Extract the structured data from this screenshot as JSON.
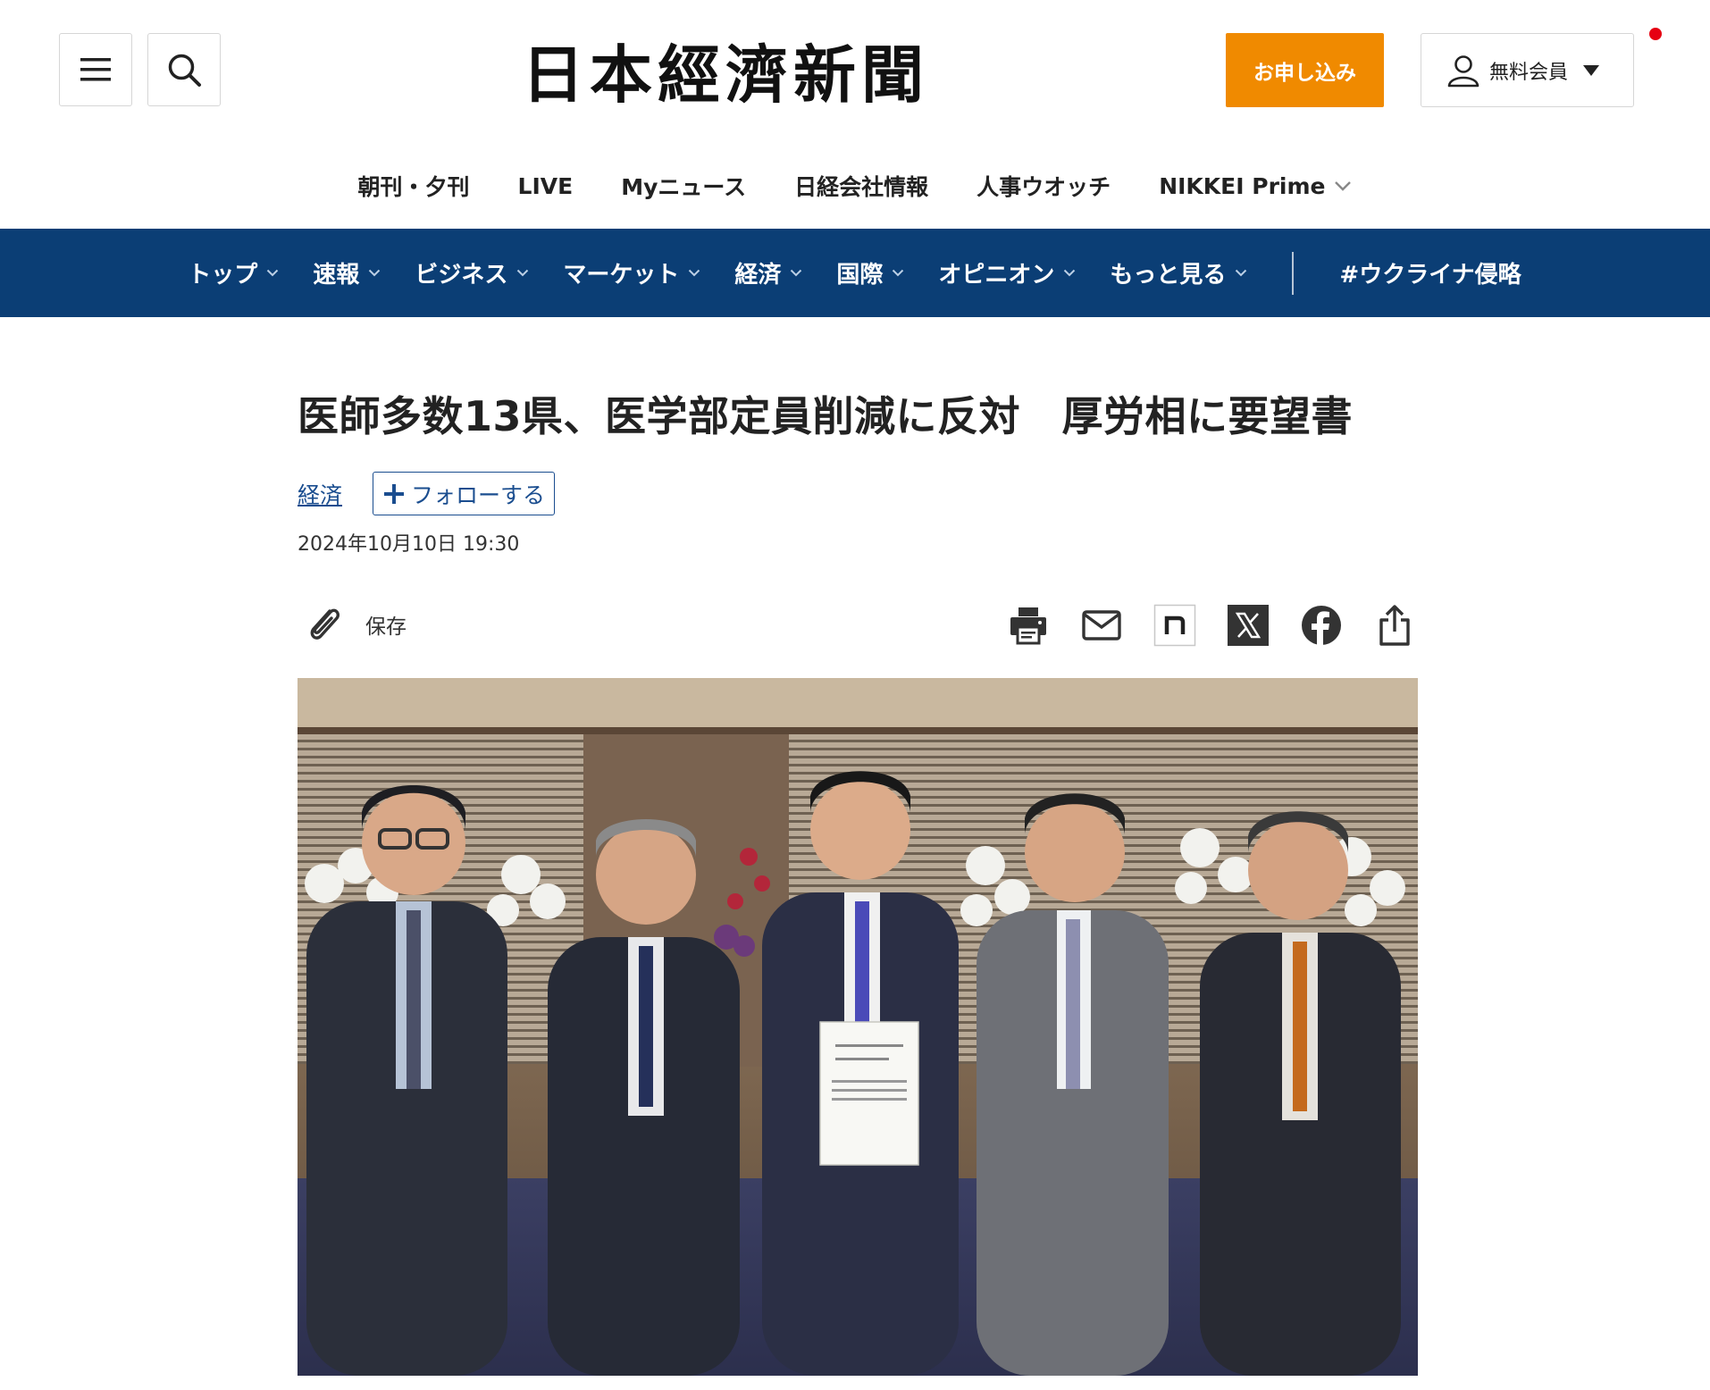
{
  "colors": {
    "nav_blue": "#0b3e75",
    "subscribe_orange": "#f08a00",
    "link_blue": "#1a4d8f",
    "notification_red": "#e60012"
  },
  "header": {
    "logo_text": "日本經濟新聞",
    "subscribe_label": "お申し込み",
    "member_label": "無料会員"
  },
  "subnav": {
    "items": [
      {
        "label": "朝刊・夕刊"
      },
      {
        "label": "LIVE"
      },
      {
        "label": "Myニュース"
      },
      {
        "label": "日経会社情報"
      },
      {
        "label": "人事ウオッチ"
      },
      {
        "label": "NIKKEI Prime"
      }
    ]
  },
  "mainnav": {
    "items": [
      {
        "label": "トップ"
      },
      {
        "label": "速報"
      },
      {
        "label": "ビジネス"
      },
      {
        "label": "マーケット"
      },
      {
        "label": "経済"
      },
      {
        "label": "国際"
      },
      {
        "label": "オピニオン"
      },
      {
        "label": "もっと見る"
      }
    ],
    "special": "#ウクライナ侵略"
  },
  "article": {
    "headline": "医師多数13県、医学部定員削減に反対　厚労相に要望書",
    "topic": "経済",
    "follow_label": "フォローする",
    "timestamp": "2024年10月10日 19:30",
    "save_label": "保存",
    "share_icons": [
      "print-icon",
      "mail-icon",
      "note-icon",
      "x-icon",
      "facebook-icon",
      "share-icon"
    ]
  }
}
